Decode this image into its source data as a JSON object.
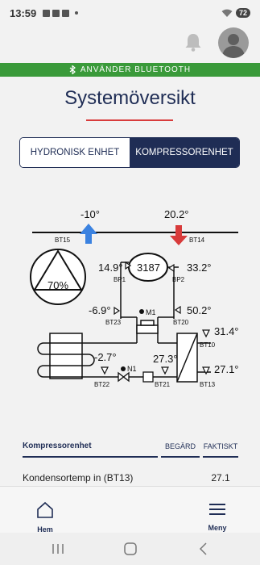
{
  "status": {
    "time": "13:59",
    "battery": "72"
  },
  "banner": {
    "text": "ANVÄNDER BLUETOOTH"
  },
  "title": "Systemöversikt",
  "tabs": [
    {
      "label": "HYDRONISK ENHET",
      "active": false
    },
    {
      "label": "KOMPRESSORENHET",
      "active": true
    }
  ],
  "diagram": {
    "temp_left": "-10°",
    "temp_right": "20.2°",
    "label_bt15": "BT15",
    "label_bt14": "BT14",
    "gauge_percent": "70%",
    "compressor_value": "3187",
    "bp1_value": "14.9°",
    "bp1_label": "BP1",
    "bp2_value": "33.2°",
    "bp2_label": "BP2",
    "bt23_value": "-6.9°",
    "bt23_label": "BT23",
    "m1_label": "M1",
    "bt20_value": "50.2°",
    "bt20_label": "BT20",
    "bt10_value": "31.4°",
    "bt10_label": "BT10",
    "bt22_value": "-2.7°",
    "bt22_label": "BT22",
    "n1_label": "N1",
    "bt21_value": "27.3°",
    "bt21_label": "BT21",
    "bt13_value": "27.1°",
    "bt13_label": "BT13",
    "colors": {
      "cold": "#3b82e0",
      "hot": "#d83b3b"
    }
  },
  "table": {
    "header_name": "Kompressorenhet",
    "header_requested": "BEGÄRD",
    "header_actual": "FAKTISKT",
    "rows": [
      {
        "name": "Kondensortemp in (BT13)",
        "requested": "",
        "actual": "27.1"
      }
    ]
  },
  "nav": {
    "home_label": "Hem",
    "menu_label": "Meny"
  }
}
